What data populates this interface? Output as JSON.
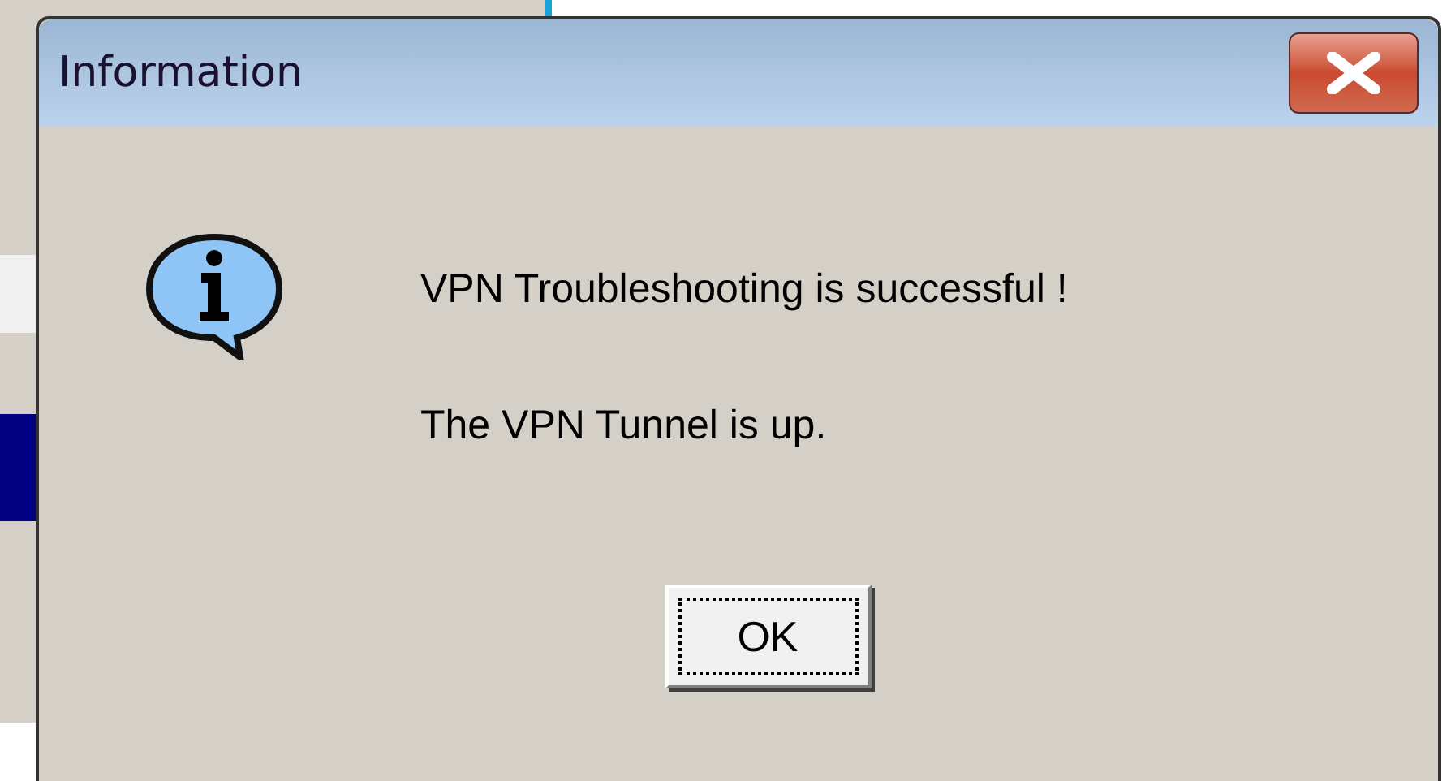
{
  "window": {
    "title": "Information"
  },
  "message": [
    "VPN Troubleshooting is successful !",
    "The VPN Tunnel is up."
  ],
  "buttons": [
    {
      "label": "OK",
      "focused": true
    }
  ]
}
